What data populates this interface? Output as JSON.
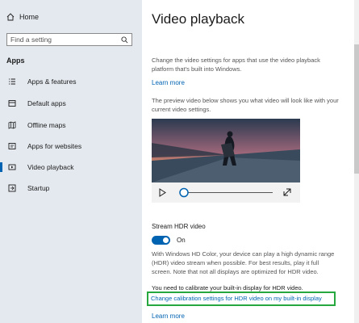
{
  "sidebar": {
    "home_label": "Home",
    "search_placeholder": "Find a setting",
    "section_title": "Apps",
    "items": [
      {
        "label": "Apps & features",
        "icon": "list-icon"
      },
      {
        "label": "Default apps",
        "icon": "default-apps-icon"
      },
      {
        "label": "Offline maps",
        "icon": "map-icon"
      },
      {
        "label": "Apps for websites",
        "icon": "web-icon"
      },
      {
        "label": "Video playback",
        "icon": "video-icon"
      },
      {
        "label": "Startup",
        "icon": "startup-icon"
      }
    ],
    "active_index": 4
  },
  "main": {
    "title": "Video playback",
    "description": "Change the video settings for apps that use the video playback platform that's built into Windows.",
    "learn_more_1": "Learn more",
    "preview_text": "The preview video below shows you what video will look like with your current video settings.",
    "hdr_heading": "Stream HDR video",
    "toggle_state": "On",
    "hdr_description": "With Windows HD Color, your device can play a high dynamic range (HDR) video stream when possible. For best results, play it full screen. Note that not all displays are optimized for HDR video.",
    "calibrate_text": "You need to calibrate your built-in display for HDR video.",
    "calibration_link": "Change calibration settings for HDR video on my built-in display",
    "learn_more_2": "Learn more"
  },
  "colors": {
    "accent": "#0063b1",
    "highlight_border": "#27a83e",
    "sidebar_bg": "#e4e9ef"
  }
}
